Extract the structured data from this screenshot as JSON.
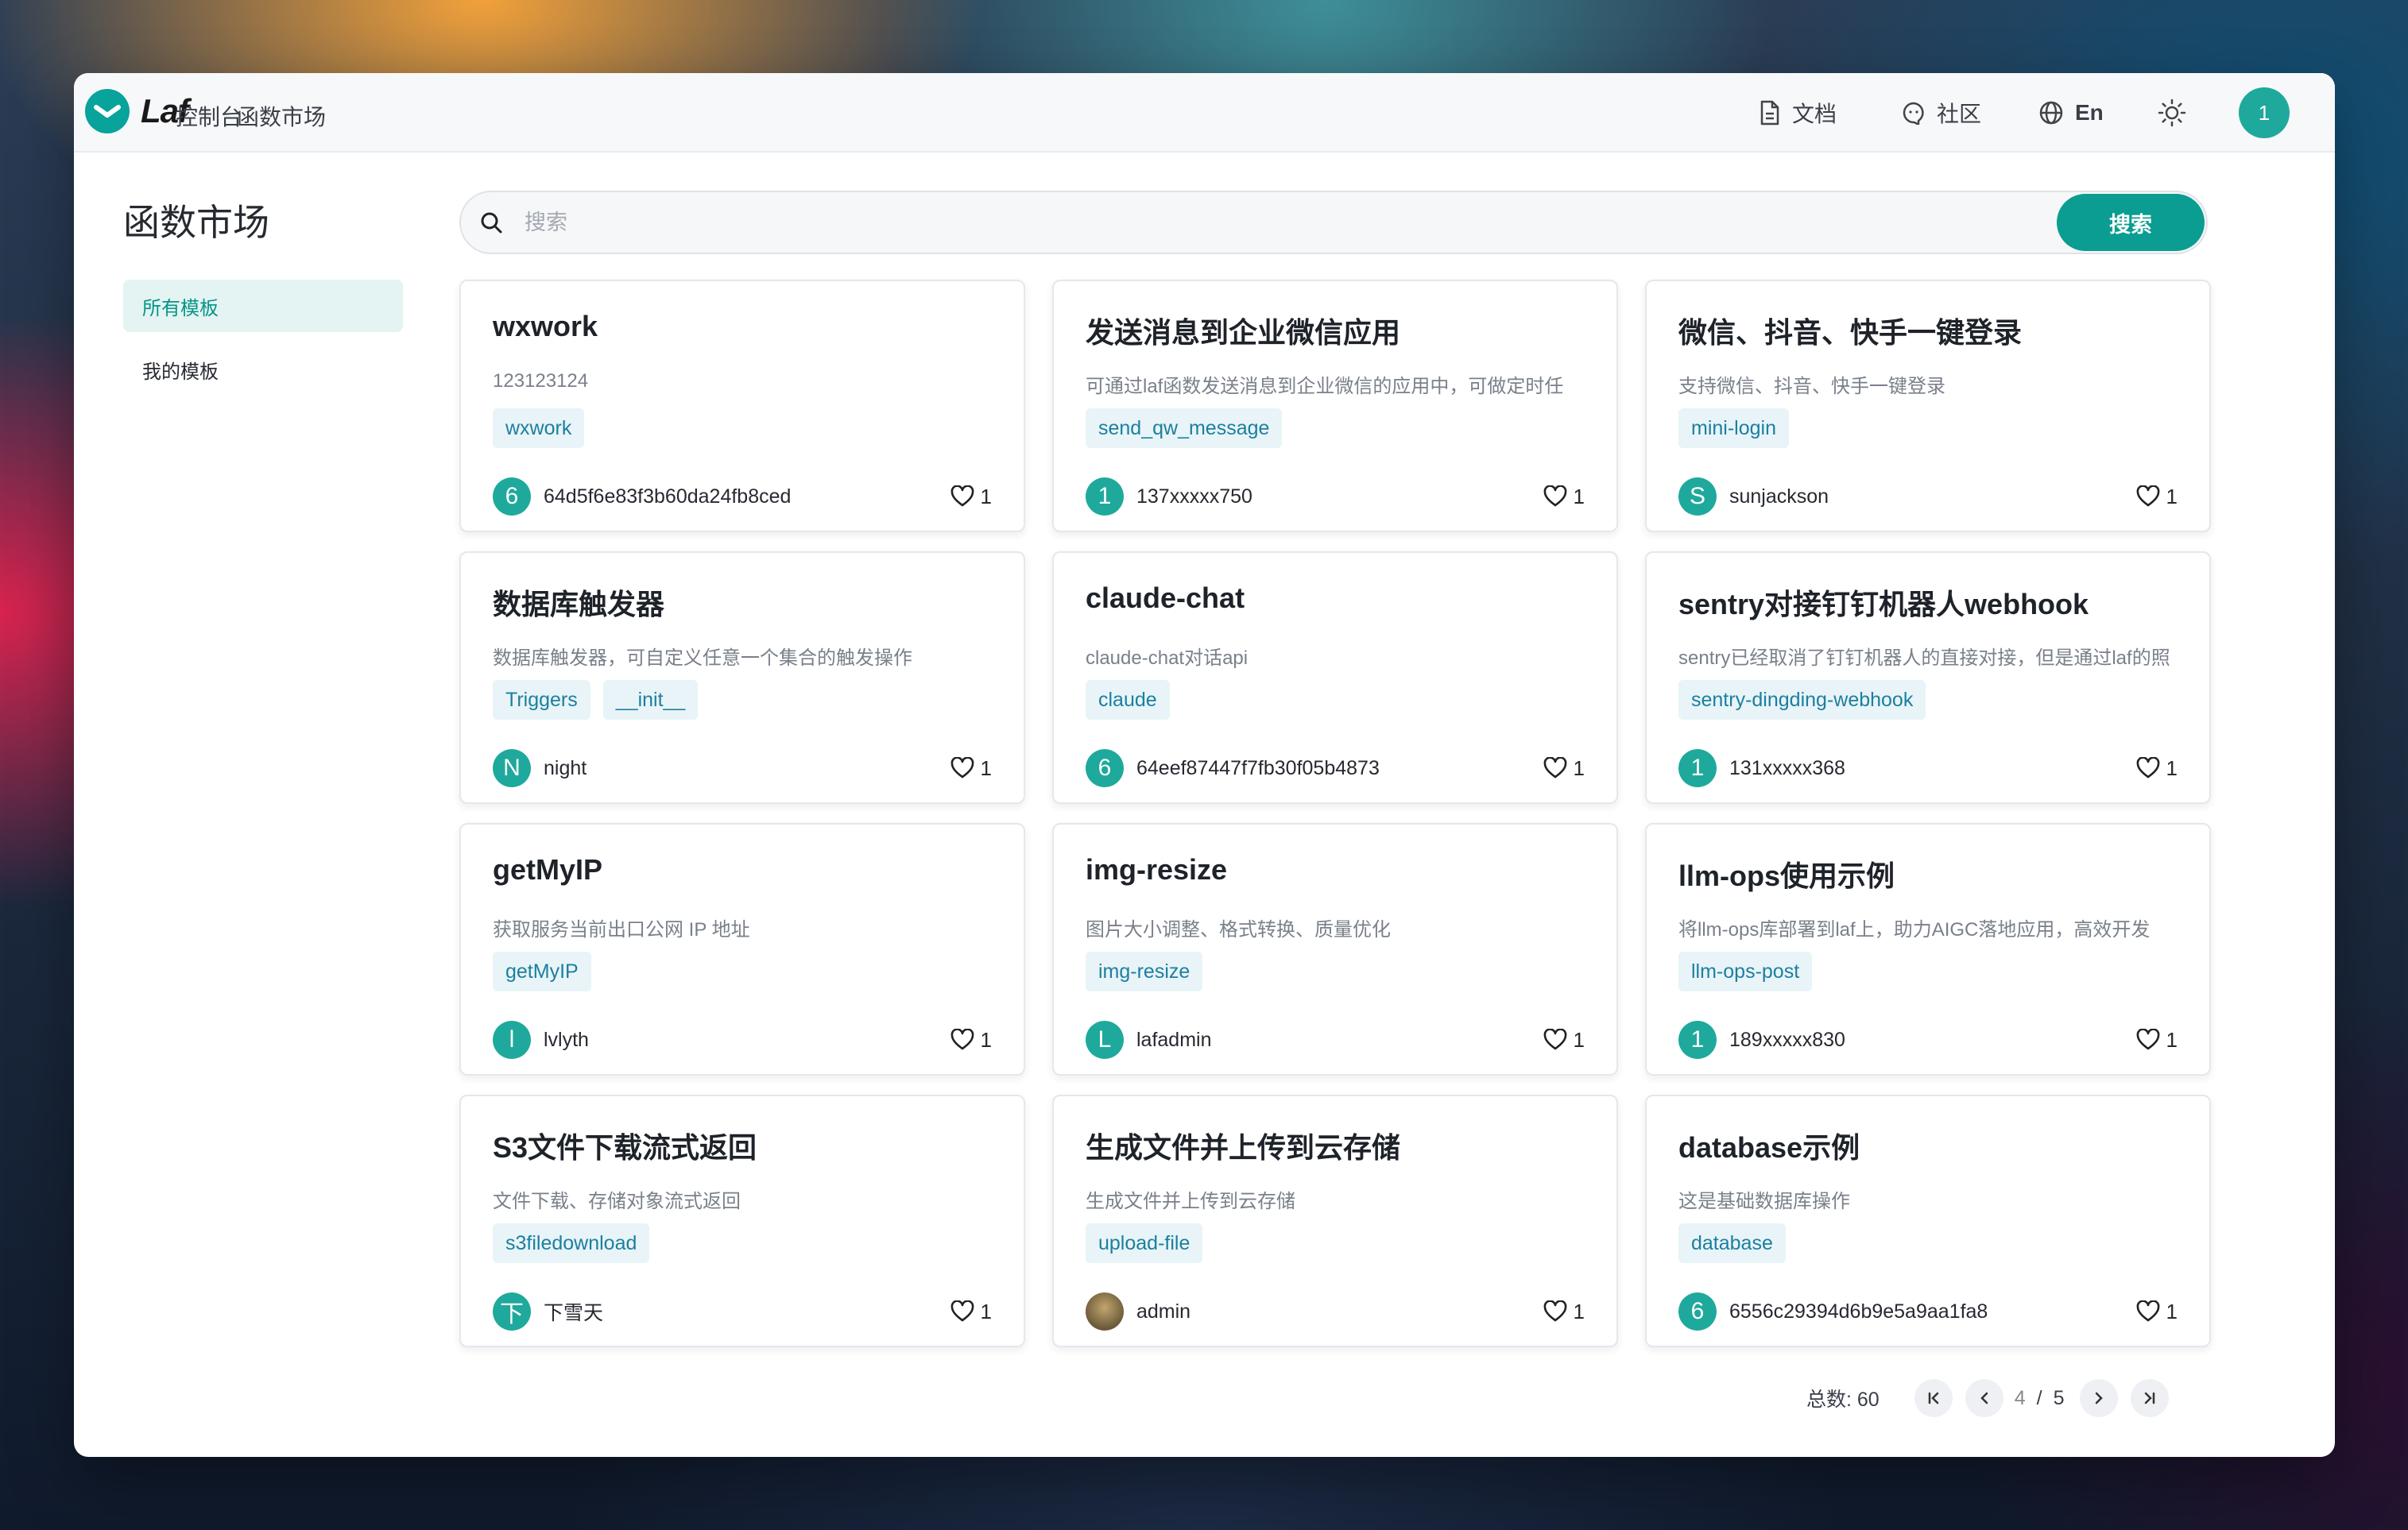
{
  "brand": {
    "name": "Laf",
    "accent": "#0b9d91"
  },
  "nav": {
    "items": [
      "控制台",
      "函数市场"
    ]
  },
  "header": {
    "docs_label": "文档",
    "community_label": "社区",
    "lang_label": "En",
    "user_initial": "1"
  },
  "sidebar": {
    "title": "函数市场",
    "items": [
      {
        "label": "所有模板",
        "active": true
      },
      {
        "label": "我的模板",
        "active": false
      }
    ]
  },
  "search": {
    "placeholder": "搜索",
    "value": "",
    "button_label": "搜索"
  },
  "cards": [
    {
      "title": "wxwork",
      "desc": "123123124",
      "tags": [
        "wxwork"
      ],
      "author_initial": "6",
      "author": "64d5f6e83f3b60da24fb8ced",
      "likes": "1"
    },
    {
      "title": "发送消息到企业微信应用",
      "desc": "可通过laf函数发送消息到企业微信的应用中，可做定时任",
      "tags": [
        "send_qw_message"
      ],
      "author_initial": "1",
      "author": "137xxxxx750",
      "likes": "1"
    },
    {
      "title": "微信、抖音、快手一键登录",
      "desc": "支持微信、抖音、快手一键登录",
      "tags": [
        "mini-login"
      ],
      "author_initial": "S",
      "author": "sunjackson",
      "likes": "1"
    },
    {
      "title": "数据库触发器",
      "desc": "数据库触发器，可自定义任意一个集合的触发操作",
      "tags": [
        "Triggers",
        "__init__"
      ],
      "author_initial": "N",
      "author": "night",
      "likes": "1"
    },
    {
      "title": "claude-chat",
      "desc": "claude-chat对话api",
      "tags": [
        "claude"
      ],
      "author_initial": "6",
      "author": "64eef87447f7fb30f05b4873",
      "likes": "1"
    },
    {
      "title": "sentry对接钉钉机器人webhook",
      "desc": "sentry已经取消了钉钉机器人的直接对接，但是通过laf的照",
      "tags": [
        "sentry-dingding-webhook"
      ],
      "author_initial": "1",
      "author": "131xxxxx368",
      "likes": "1"
    },
    {
      "title": "getMyIP",
      "desc": "获取服务当前出口公网 IP 地址",
      "tags": [
        "getMyIP"
      ],
      "author_initial": "l",
      "author": "lvlyth",
      "likes": "1"
    },
    {
      "title": "img-resize",
      "desc": "图片大小调整、格式转换、质量优化",
      "tags": [
        "img-resize"
      ],
      "author_initial": "L",
      "author": "lafadmin",
      "likes": "1"
    },
    {
      "title": "llm-ops使用示例",
      "desc": "将llm-ops库部署到laf上，助力AIGC落地应用，高效开发",
      "tags": [
        "llm-ops-post"
      ],
      "author_initial": "1",
      "author": "189xxxxx830",
      "likes": "1"
    },
    {
      "title": "S3文件下载流式返回",
      "desc": "文件下载、存储对象流式返回",
      "tags": [
        "s3filedownload"
      ],
      "author_initial": "下",
      "author": "下雪天",
      "likes": "1"
    },
    {
      "title": "生成文件并上传到云存储",
      "desc": "生成文件并上传到云存储",
      "tags": [
        "upload-file"
      ],
      "author_initial": "",
      "author": "admin",
      "likes": "1",
      "photo": true
    },
    {
      "title": "database示例",
      "desc": "这是基础数据库操作",
      "tags": [
        "database"
      ],
      "author_initial": "6",
      "author": "6556c29394d6b9e5a9aa1fa8",
      "likes": "1"
    }
  ],
  "pagination": {
    "total_label": "总数: 60",
    "current": "4",
    "separator": "/",
    "total_pages": "5"
  }
}
